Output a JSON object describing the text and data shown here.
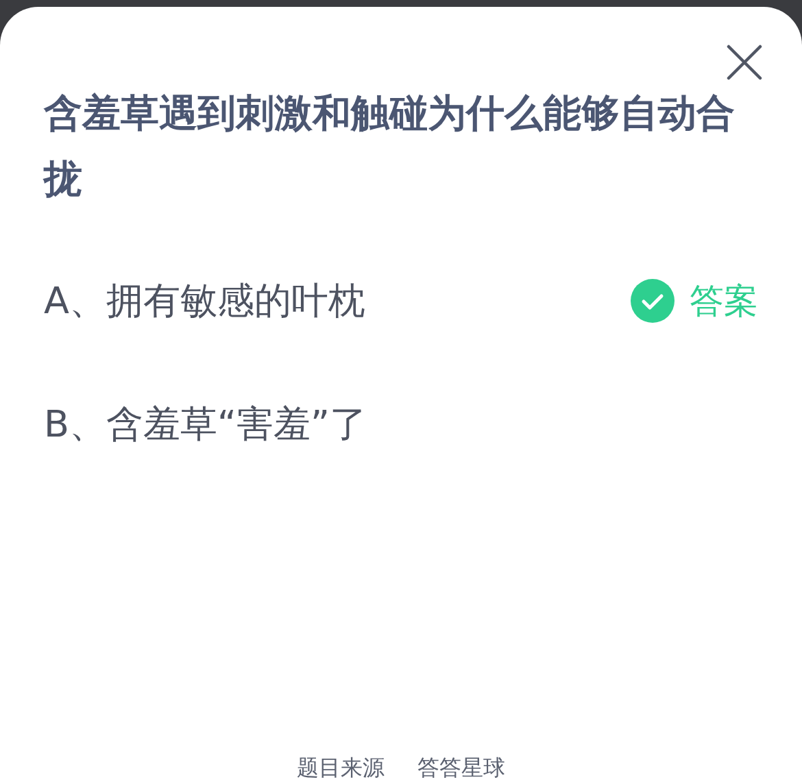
{
  "question": "含羞草遇到刺激和触碰为什么能够自动合拢",
  "options": [
    {
      "text": "A、拥有敏感的叶枕",
      "correct": true,
      "answer_label": "答案"
    },
    {
      "text": "B、含羞草“害羞”了",
      "correct": false
    }
  ],
  "footer": {
    "source_label": "题目来源",
    "source": "答答星球"
  }
}
